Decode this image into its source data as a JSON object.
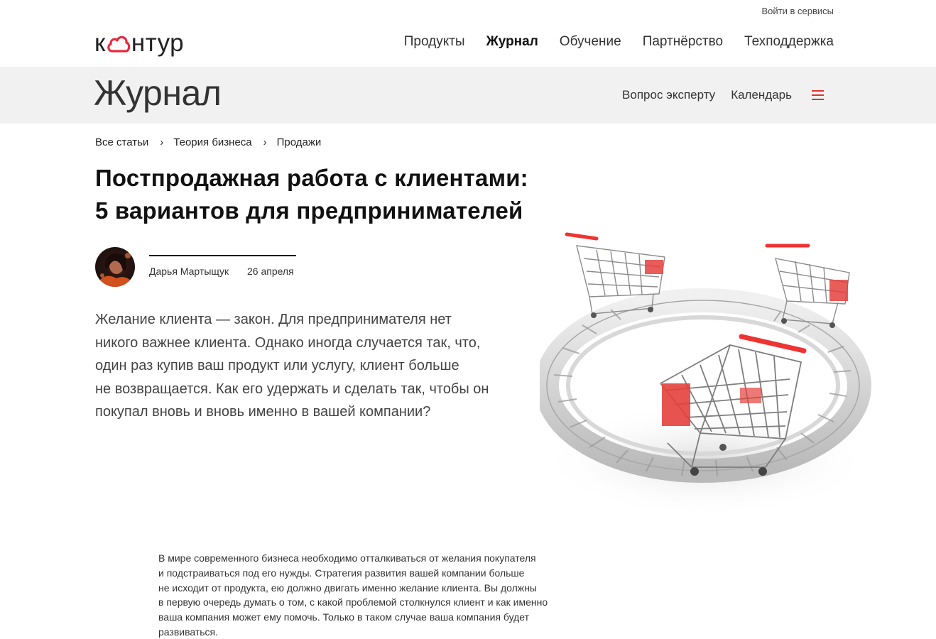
{
  "header": {
    "login_link": "Войти в сервисы",
    "logo": {
      "part1": "к",
      "part2": "нтур",
      "accent_color": "#e9283a"
    },
    "nav": [
      {
        "label": "Продукты",
        "active": false
      },
      {
        "label": "Журнал",
        "active": true
      },
      {
        "label": "Обучение",
        "active": false
      },
      {
        "label": "Партнёрство",
        "active": false
      },
      {
        "label": "Техподдержка",
        "active": false
      }
    ]
  },
  "journal_bar": {
    "title": "Журнал",
    "links": [
      "Вопрос эксперту",
      "Календарь"
    ],
    "menu_icon": "hamburger-icon",
    "menu_color": "#e03030"
  },
  "breadcrumb": [
    "Все статьи",
    "Теория бизнеса",
    "Продажи"
  ],
  "article": {
    "title_lines": [
      "Постпродажная работа с клиентами:",
      "5 вариантов для предпринимателей"
    ],
    "author": "Дарья Мартыщук",
    "date": "26 апреля",
    "lead_lines": [
      "Желание клиента — закон. Для предпринимателя нет",
      "никого важнее клиента. Однако иногда случается так, что,",
      "один раз купив ваш продукт или услугу, клиент больше",
      "не возвращается. Как его удержать и сделать так, чтобы он",
      "покупал вновь и вновь именно в вашей компании?"
    ],
    "body_lines": [
      "В мире современного бизнеса необходимо отталкиваться от желания покупателя",
      "и подстраиваться под его нужды. Стратегия развития вашей компании больше",
      "не исходит от продукта, ею должно двигать именно желание клиента. Вы должны",
      "в первую очередь думать о том, с какой проблемой столкнулся клиент и как именно",
      "ваша компания может ему помочь. Только в таком случае ваша компания будет",
      "развиваться."
    ]
  }
}
